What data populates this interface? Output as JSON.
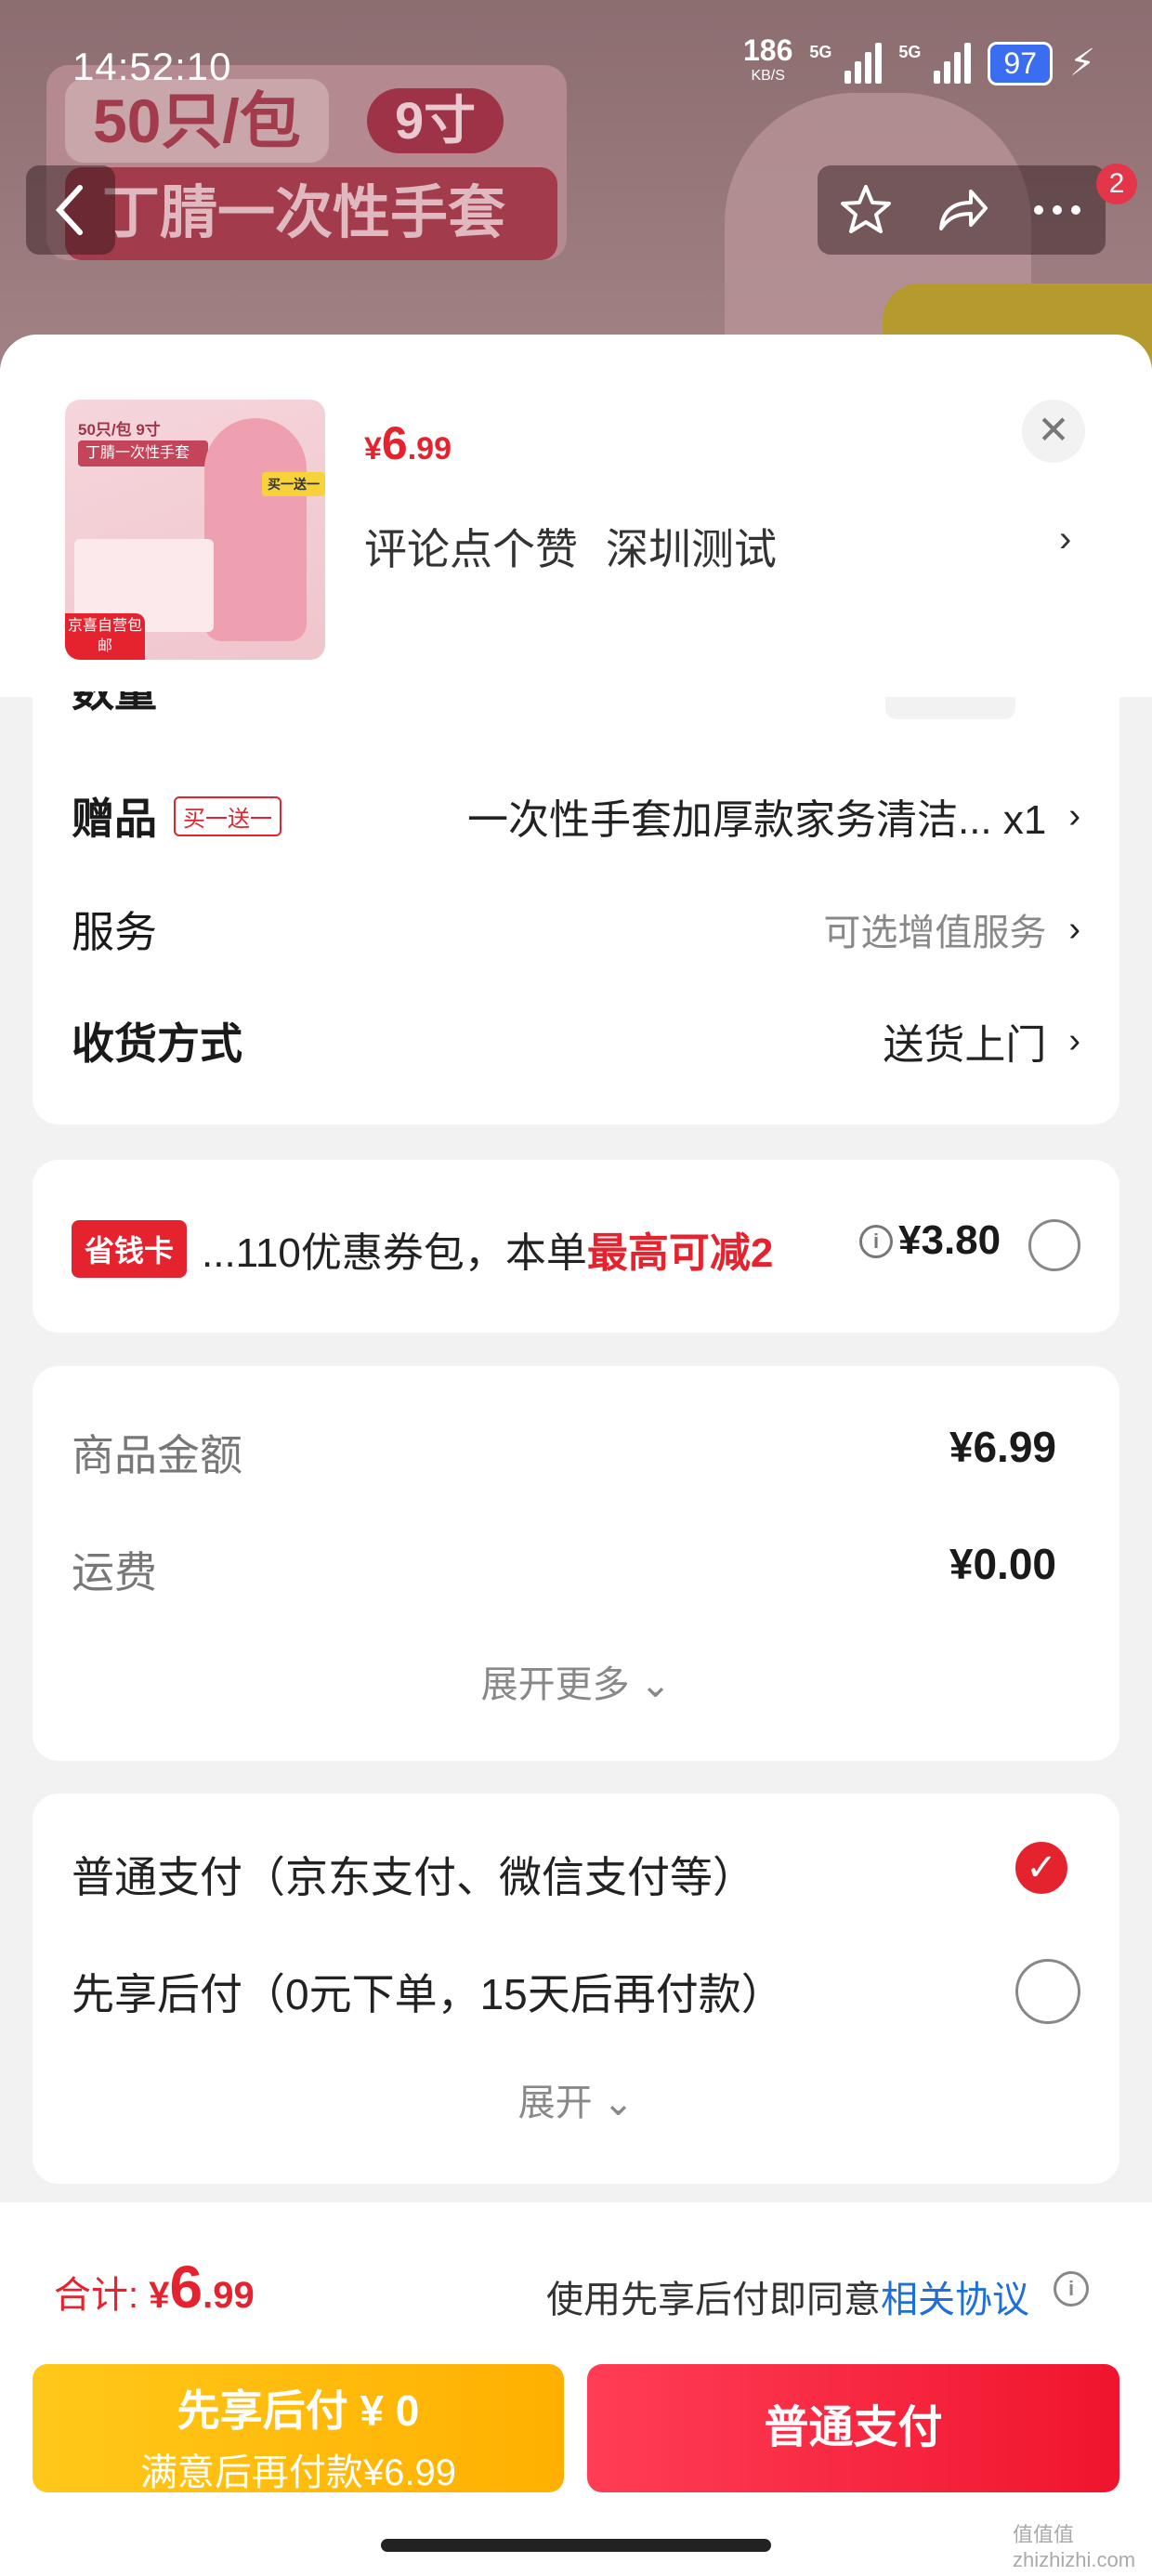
{
  "status_bar": {
    "time": "14:52:10",
    "speed_value": "186",
    "speed_unit": "KB/S",
    "signal1_label": "5G",
    "signal2_label": "5G",
    "battery": "97"
  },
  "background": {
    "chip_text": "50只/包",
    "size_text": "9寸",
    "title_text": "丁腈一次性手套"
  },
  "nav": {
    "cart_badge": "2"
  },
  "product": {
    "thumb_line1": "50只/包  9寸",
    "thumb_line2": "丁腈一次性手套",
    "thumb_tag": "买一送一",
    "thumb_seal": "京喜自营包邮",
    "price_symbol": "¥",
    "price_int": "6",
    "price_dec": ".99",
    "meta1": "评论点个赞",
    "meta2": "深圳测试"
  },
  "options": {
    "quantity_label": "数量",
    "gift_label": "赠品",
    "gift_tag": "买一送一",
    "gift_value": "一次性手套加厚款家务清洁... x1",
    "service_label": "服务",
    "service_value": "可选增值服务",
    "delivery_label": "收货方式",
    "delivery_value": "送货上门"
  },
  "coupon": {
    "badge": "省钱卡",
    "text_prefix": "...110优惠券包，本单",
    "text_highlight": "最高可减2",
    "amount": "¥3.80"
  },
  "amount": {
    "goods_label": "商品金额",
    "goods_value": "¥6.99",
    "shipping_label": "运费",
    "shipping_value": "¥0.00",
    "expand_more": "展开更多"
  },
  "payment": {
    "option1": "普通支付（京东支付、微信支付等）",
    "option2": "先享后付（0元下单，15天后再付款）",
    "expand": "展开"
  },
  "bottom": {
    "total_label": "合计: ",
    "total_symbol": "¥",
    "total_int": "6",
    "total_dec": ".99",
    "agree_text": "使用先享后付即同意",
    "agree_link": "相关协议",
    "btn_later_line1": "先享后付 ¥ 0",
    "btn_later_line2": "满意后再付款¥6.99",
    "btn_pay": "普通支付"
  },
  "watermark": "值值值 zhizhizhi.com",
  "colors": {
    "accent_red": "#e4232e",
    "link_blue": "#1f6fd8",
    "yellow_button": "#ffb000"
  }
}
